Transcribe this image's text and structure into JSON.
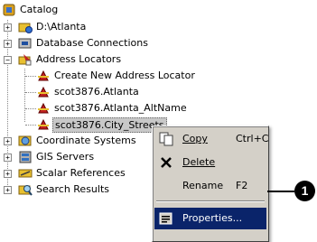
{
  "tree": {
    "root": {
      "label": "Catalog",
      "icon": "catalog-icon"
    },
    "items": [
      {
        "label": "D:\\Atlanta",
        "icon": "folder-connection-icon",
        "expander": "+"
      },
      {
        "label": "Database Connections",
        "icon": "database-connections-icon",
        "expander": "+"
      },
      {
        "label": "Address Locators",
        "icon": "address-locators-icon",
        "expander": "−"
      },
      {
        "label": "Create New Address Locator",
        "icon": "create-locator-icon"
      },
      {
        "label": "scot3876.Atlanta",
        "icon": "address-locator-icon"
      },
      {
        "label": "scot3876.Atlanta_AltName",
        "icon": "address-locator-icon"
      },
      {
        "label": "scot3876.City_Streets",
        "icon": "address-locator-icon",
        "selected": true
      },
      {
        "label": "Coordinate Systems",
        "icon": "coordinate-systems-icon",
        "expander": "+"
      },
      {
        "label": "GIS Servers",
        "icon": "gis-servers-icon",
        "expander": "+"
      },
      {
        "label": "Scalar References",
        "icon": "scalar-references-icon",
        "expander": "+"
      },
      {
        "label": "Search Results",
        "icon": "search-results-icon",
        "expander": "+"
      }
    ]
  },
  "context_menu": {
    "items": [
      {
        "label": "Copy",
        "shortcut": "Ctrl+C",
        "icon": "copy-icon"
      },
      {
        "label": "Delete",
        "shortcut": "",
        "icon": "delete-icon"
      },
      {
        "label": "Rename",
        "shortcut": "F2",
        "icon": ""
      },
      {
        "label": "Properties...",
        "shortcut": "",
        "icon": "properties-icon",
        "highlighted": true
      }
    ]
  },
  "callout": {
    "number": "1"
  },
  "colors": {
    "selection": "#0a246a",
    "menu_bg": "#d4d0c8",
    "callout": "#000000"
  }
}
